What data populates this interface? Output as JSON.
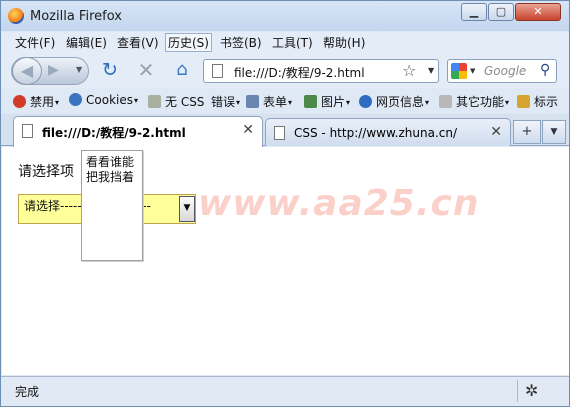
{
  "window": {
    "title": "Mozilla Firefox"
  },
  "menu": [
    {
      "label": "文件(F)",
      "active": false
    },
    {
      "label": "编辑(E)",
      "active": false
    },
    {
      "label": "查看(V)",
      "active": false
    },
    {
      "label": "历史(S)",
      "active": true
    },
    {
      "label": "书签(B)",
      "active": false
    },
    {
      "label": "工具(T)",
      "active": false
    },
    {
      "label": "帮助(H)",
      "active": false
    }
  ],
  "nav": {
    "url": "file:///D:/教程/9-2.html",
    "search_placeholder": "Google"
  },
  "bookmarks": [
    {
      "label": "禁用",
      "icon": "block-icon",
      "color": "#d23a2a"
    },
    {
      "label": "Cookies",
      "icon": "cookie-user-icon",
      "color": "#3a74c0"
    },
    {
      "label": "无 CSS",
      "icon": "css-icon",
      "color": "#a8b0a0"
    },
    {
      "label": "错误",
      "icon": "none",
      "color": ""
    },
    {
      "label": "表单",
      "icon": "form-icon",
      "color": "#6a86b0"
    },
    {
      "label": "图片",
      "icon": "image-icon",
      "color": "#4d8a4a"
    },
    {
      "label": "网页信息",
      "icon": "info-icon",
      "color": "#2f6bc2"
    },
    {
      "label": "其它功能",
      "icon": "gear-icon",
      "color": "#b8b8b8"
    },
    {
      "label": "标示",
      "icon": "pencil-icon",
      "color": "#d6a531"
    }
  ],
  "tabs": [
    {
      "label": "file:///D:/教程/9-2.html",
      "active": true
    },
    {
      "label": "CSS - http://www.zhuna.cn/",
      "active": false
    }
  ],
  "page": {
    "prompt": "请选择项",
    "select_value": "请选择---------------------",
    "popup_text": "看看谁能把我挡着",
    "watermark": "www.aa25.cn"
  },
  "status": {
    "text": "完成"
  }
}
